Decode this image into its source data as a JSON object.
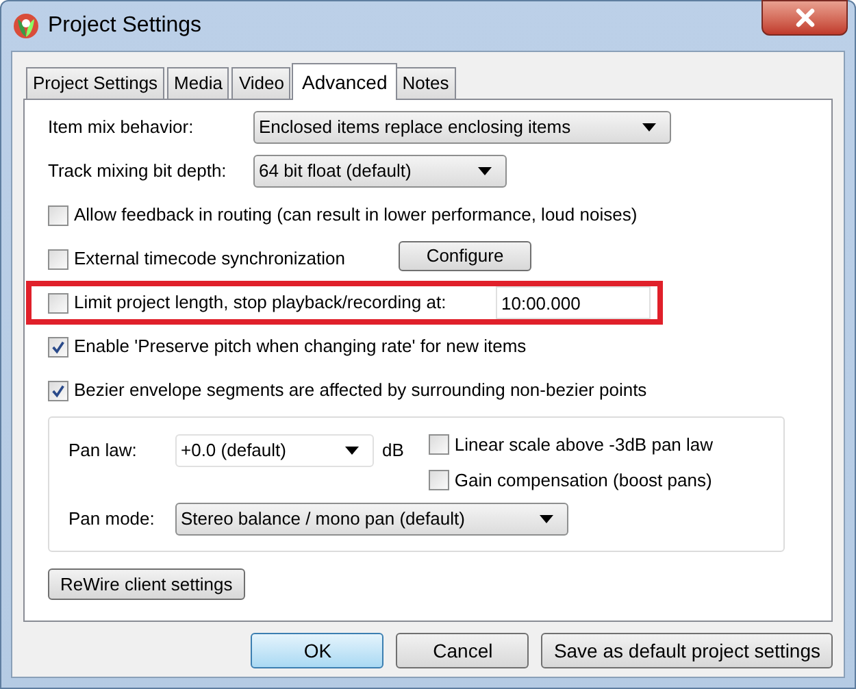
{
  "window": {
    "title": "Project Settings"
  },
  "tabs": [
    {
      "label": "Project Settings",
      "selected": false
    },
    {
      "label": "Media",
      "selected": false
    },
    {
      "label": "Video",
      "selected": false
    },
    {
      "label": "Advanced",
      "selected": true
    },
    {
      "label": "Notes",
      "selected": false
    }
  ],
  "options": [
    {
      "kind": "dropdown",
      "label": "Item mix behavior:",
      "value": "Enclosed items replace enclosing items"
    },
    {
      "kind": "dropdown",
      "label": "Track mixing bit depth:",
      "value": "64 bit float (default)"
    },
    {
      "kind": "checkbox",
      "label": "Allow feedback in routing (can result in lower performance, loud noises)",
      "checked": false,
      "highlighted": false
    },
    {
      "kind": "checkbox",
      "label": "External timecode synchronization",
      "checked": false,
      "highlighted": false,
      "button": "Configure"
    },
    {
      "kind": "checkbox",
      "label": "Limit project length, stop playback/recording at:",
      "checked": false,
      "highlighted": true,
      "field_value": "10:00.000"
    },
    {
      "kind": "checkbox",
      "label": "Enable 'Preserve pitch when changing rate' for new items",
      "checked": true,
      "highlighted": false
    },
    {
      "kind": "checkbox",
      "label": "Bezier envelope segments are affected by surrounding non-bezier points",
      "checked": true,
      "highlighted": false
    }
  ],
  "pan": {
    "pan_law": {
      "label": "Pan law:",
      "value": "+0.0 (default)",
      "unit": "dB"
    },
    "checkboxes": [
      {
        "label": "Linear scale above -3dB pan law",
        "checked": false
      },
      {
        "label": "Gain compensation (boost pans)",
        "checked": false
      }
    ],
    "pan_mode": {
      "label": "Pan mode:",
      "value": "Stereo balance / mono pan (default)"
    }
  },
  "rewire_button": "ReWire client settings",
  "buttons": [
    {
      "label": "OK",
      "default": true
    },
    {
      "label": "Cancel",
      "default": false
    },
    {
      "label": "Save as default project settings",
      "default": false
    }
  ]
}
